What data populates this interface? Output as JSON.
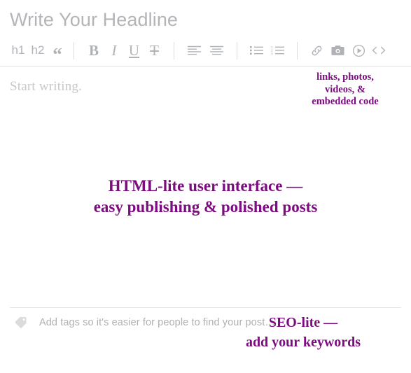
{
  "editor": {
    "headline_placeholder": "Write Your Headline",
    "body_placeholder": "Start writing.",
    "tag_placeholder": "Add tags so it's easier for people to find your post…"
  },
  "toolbar": {
    "groups": [
      {
        "name": "block-styles",
        "items": [
          {
            "name": "heading-1-button",
            "label": "h1",
            "icon": "h1-text"
          },
          {
            "name": "heading-2-button",
            "label": "h2",
            "icon": "h2-text"
          },
          {
            "name": "blockquote-button",
            "label": "“",
            "icon": "quote-icon"
          }
        ]
      },
      {
        "name": "inline-styles",
        "items": [
          {
            "name": "bold-button",
            "label": "B",
            "icon": "bold-icon"
          },
          {
            "name": "italic-button",
            "label": "I",
            "icon": "italic-icon"
          },
          {
            "name": "underline-button",
            "label": "U",
            "icon": "underline-icon"
          },
          {
            "name": "strikethrough-button",
            "label": "T",
            "icon": "strikethrough-icon"
          }
        ]
      },
      {
        "name": "alignment",
        "items": [
          {
            "name": "align-left-button",
            "label": "",
            "icon": "align-left-icon"
          },
          {
            "name": "align-center-button",
            "label": "",
            "icon": "align-center-icon"
          }
        ]
      },
      {
        "name": "lists",
        "items": [
          {
            "name": "bulleted-list-button",
            "label": "",
            "icon": "bulleted-list-icon"
          },
          {
            "name": "numbered-list-button",
            "label": "",
            "icon": "numbered-list-icon"
          }
        ]
      },
      {
        "name": "media",
        "items": [
          {
            "name": "insert-link-button",
            "label": "",
            "icon": "link-icon"
          },
          {
            "name": "insert-photo-button",
            "label": "",
            "icon": "camera-icon"
          },
          {
            "name": "insert-video-button",
            "label": "",
            "icon": "play-circle-icon"
          },
          {
            "name": "embed-code-button",
            "label": "",
            "icon": "code-brackets-icon"
          }
        ]
      }
    ]
  },
  "annotations": {
    "media": {
      "line1": "links, photos,",
      "line2": "videos, &",
      "line3": "embedded code"
    },
    "center": {
      "line1": "HTML-lite user interface —",
      "line2": "easy publishing & polished posts"
    },
    "seo": {
      "line1": "SEO-lite —",
      "line2": "add your keywords"
    }
  },
  "colors": {
    "annotation_purple": "#7d0c80",
    "placeholder_gray": "#b3b5b8",
    "toolbar_icon_gray": "#b0b2b5",
    "divider_gray": "#e2e2e2",
    "background": "#ffffff"
  }
}
